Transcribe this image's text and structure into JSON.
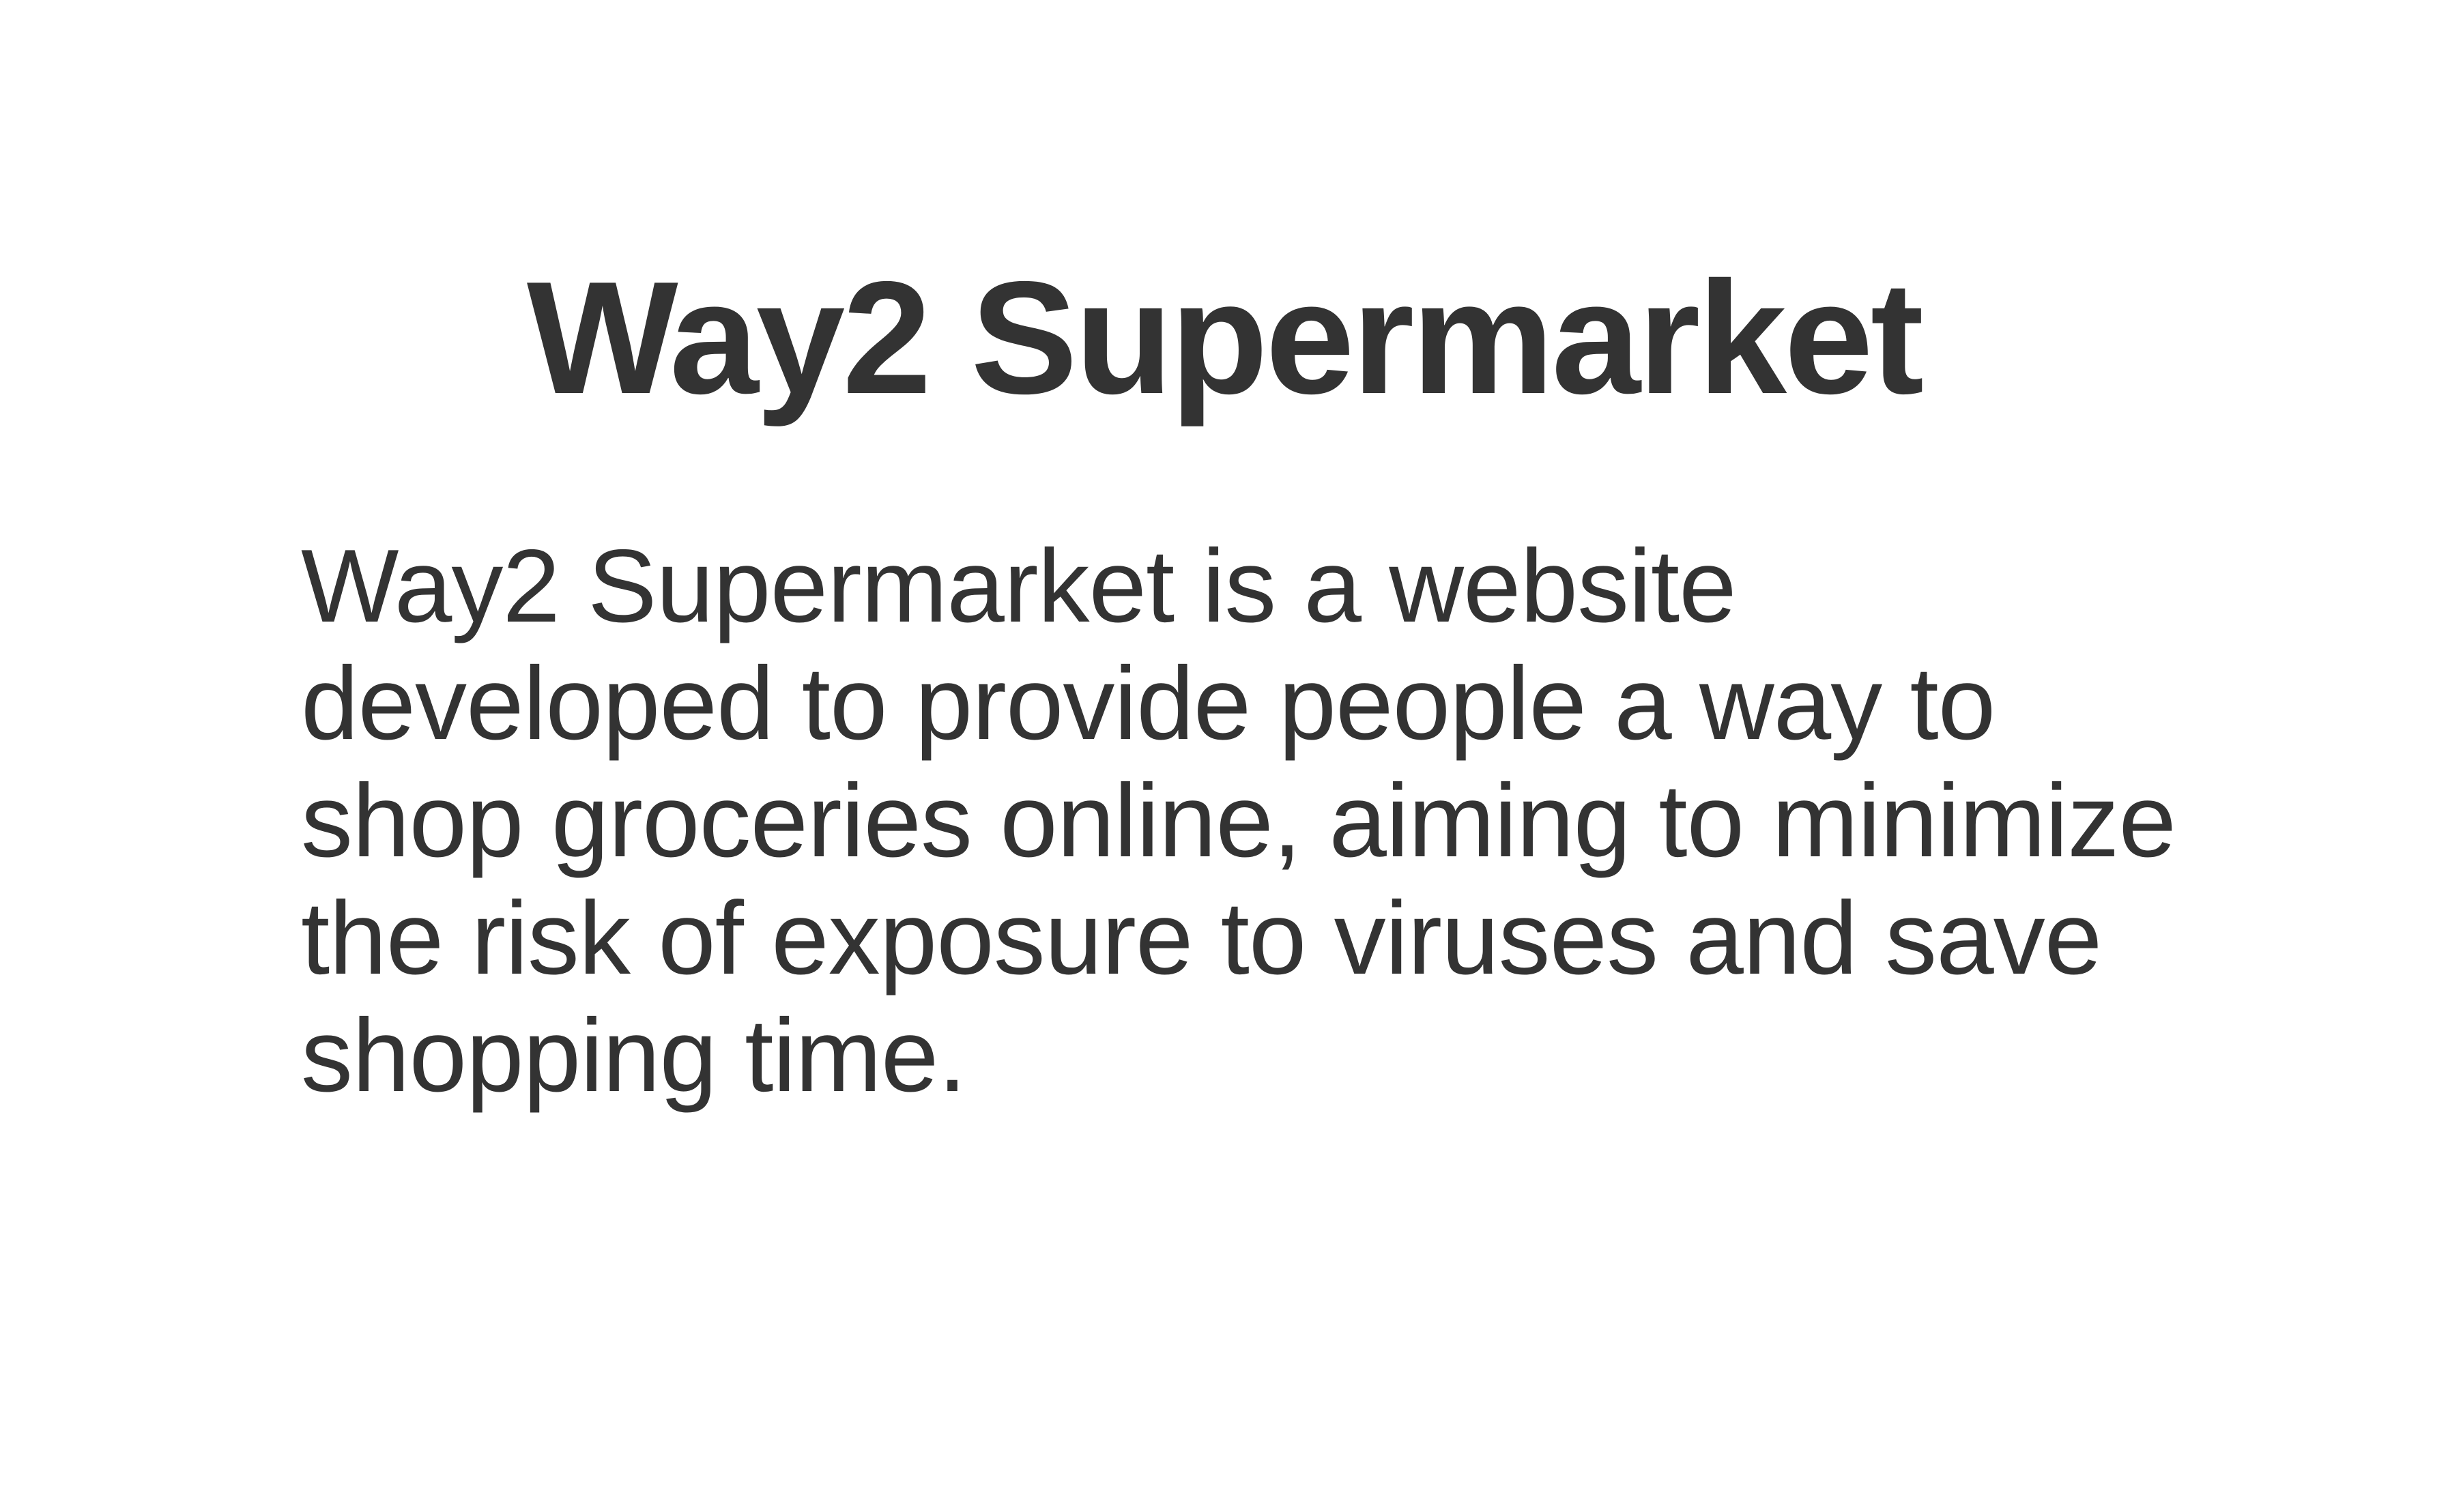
{
  "slide": {
    "title": "Way2 Supermarket",
    "description": "Way2 Supermarket is a website developed to provide people a way to shop groceries online, aiming to minimize the risk of exposure to viruses and save shopping time."
  },
  "colors": {
    "background": "#ffffff",
    "text": "#333333"
  }
}
